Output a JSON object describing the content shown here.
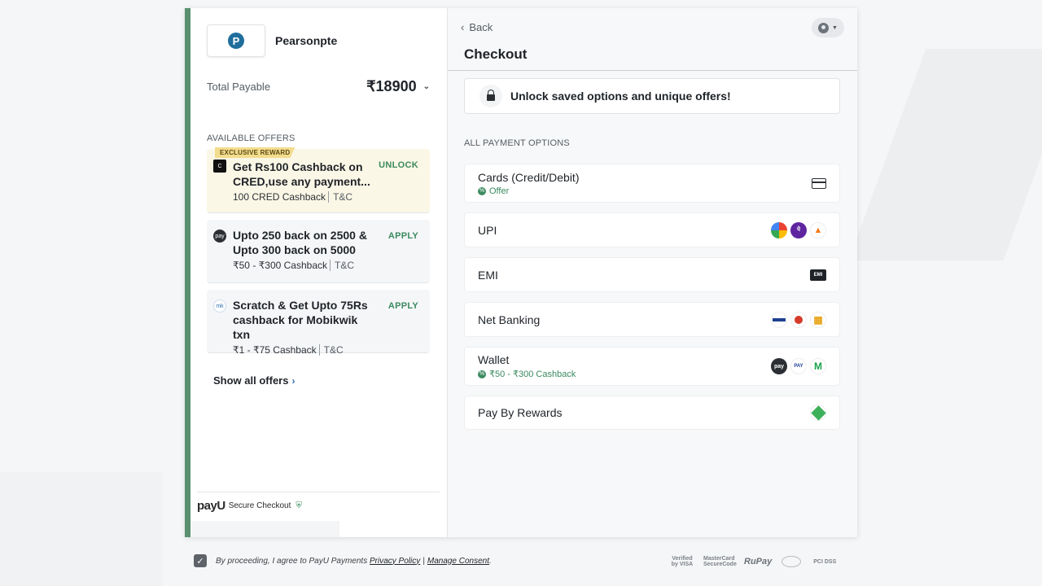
{
  "merchant": {
    "name": "Pearsonpte",
    "logo_letter": "P"
  },
  "total": {
    "label": "Total Payable",
    "amount": "₹18900"
  },
  "offers": {
    "heading": "AVAILABLE OFFERS",
    "items": [
      {
        "badge": "EXCLUSIVE REWARD",
        "icon": "cred-icon",
        "title": "Get Rs100 Cashback on CRED,use any payment...",
        "sub": "100 CRED Cashback",
        "tc": "T&C",
        "action": "UNLOCK",
        "icon_label": "C"
      },
      {
        "icon": "paytm-wallet-icon",
        "title": "Upto 250 back on 2500 & Upto 300 back on 5000",
        "sub": "₹50 - ₹300 Cashback",
        "tc": "T&C",
        "action": "APPLY",
        "icon_label": "pay"
      },
      {
        "icon": "mobikwik-icon",
        "title": "Scratch & Get Upto 75Rs cashback for Mobikwik txn",
        "sub": "₹1 - ₹75 Cashback",
        "tc": "T&C",
        "action": "APPLY",
        "icon_label": "mk"
      }
    ],
    "show_all": "Show all offers"
  },
  "footer_left": {
    "brand": "payU",
    "secure": "Secure Checkout"
  },
  "header": {
    "back": "Back",
    "title": "Checkout"
  },
  "unlock": {
    "text": "Unlock saved options and unique offers!"
  },
  "payment": {
    "heading": "ALL PAYMENT OPTIONS",
    "options": [
      {
        "label": "Cards (Credit/Debit)",
        "sub": "Offer",
        "icon": "card-icon"
      },
      {
        "label": "UPI",
        "icon": "upi-icons"
      },
      {
        "label": "EMI",
        "icon": "emi-icon",
        "icon_text": "EMI"
      },
      {
        "label": "Net Banking",
        "icon": "bank-icons"
      },
      {
        "label": "Wallet",
        "sub": "₹50 - ₹300 Cashback",
        "icon": "wallet-icons"
      },
      {
        "label": "Pay By Rewards",
        "icon": "rewards-icon"
      }
    ]
  },
  "consent": {
    "prefix": "By proceeding, I agree to PayU Payments",
    "privacy": "Privacy Policy",
    "separator": "|",
    "manage": "Manage Consent",
    "suffix": "."
  },
  "badges": {
    "visa": "Verified by VISA",
    "mastercard": "MasterCard SecureCode",
    "rupay": "RuPay",
    "pci": "PCI DSS"
  },
  "colors": {
    "accent": "#3b8a5f",
    "left_border": "#5a8f6f"
  }
}
